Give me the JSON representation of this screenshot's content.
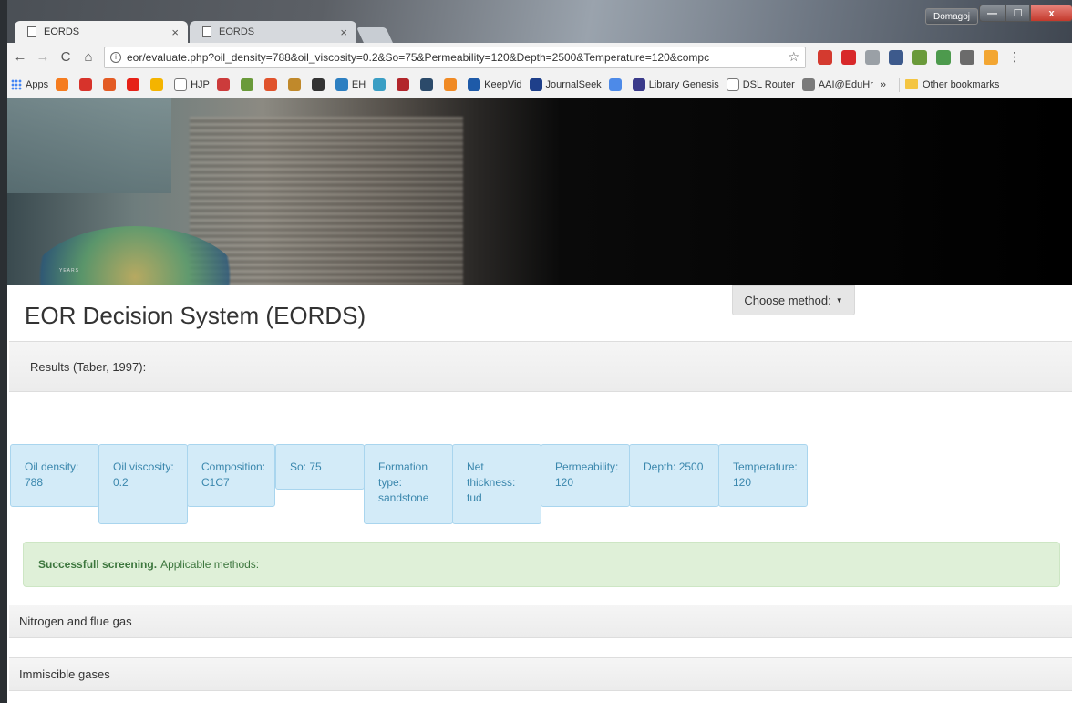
{
  "browser": {
    "tabs": [
      {
        "title": "EORDS",
        "active": true
      },
      {
        "title": "EORDS",
        "active": false
      }
    ],
    "profile_name": "Domagoj",
    "window_buttons": {
      "minimize": "—",
      "maximize": "☐",
      "close": "x"
    },
    "nav": {
      "back": "←",
      "forward": "→",
      "reload": "C",
      "home": "⌂"
    },
    "address": {
      "info": "i",
      "url": "eor/evaluate.php?oil_density=788&oil_viscosity=0.2&So=75&Permeability=120&Depth=2500&Temperature=120&compc",
      "star": "☆"
    },
    "menu": "⋮",
    "bookmarks": [
      {
        "label": "Apps",
        "icon": "apps-grid-icon"
      },
      {
        "label": "",
        "icon": "firefox-icon",
        "color": "#f57c1f"
      },
      {
        "label": "",
        "icon": "bank-icon",
        "color": "#d7332b"
      },
      {
        "label": "",
        "icon": "e-icon",
        "color": "#e35b24"
      },
      {
        "label": "",
        "icon": "youtube-icon",
        "color": "#e62117"
      },
      {
        "label": "",
        "icon": "drive-icon",
        "color": "#f4b400"
      },
      {
        "label": "HJP",
        "icon": "doc-icon",
        "color": "#ffffff"
      },
      {
        "label": "",
        "icon": "mendeley-icon",
        "color": "#cc3b3b"
      },
      {
        "label": "",
        "icon": "arrow-icon",
        "color": "#6a9a3a"
      },
      {
        "label": "",
        "icon": "sun-icon",
        "color": "#e0532c"
      },
      {
        "label": "",
        "icon": "lion-icon",
        "color": "#c0892b"
      },
      {
        "label": "",
        "icon": "t-icon",
        "color": "#333333"
      },
      {
        "label": "EH",
        "icon": "eh-icon",
        "color": "#2d7fc1"
      },
      {
        "label": "",
        "icon": "yb-icon",
        "color": "#3a9ec4"
      },
      {
        "label": "",
        "icon": "nist-icon",
        "color": "#b2262b"
      },
      {
        "label": "",
        "icon": "c-icon",
        "color": "#2b4a6a"
      },
      {
        "label": "",
        "icon": "orange-icon",
        "color": "#f08a24"
      },
      {
        "label": "KeepVid",
        "icon": "keepvid-icon",
        "color": "#1e5aa8"
      },
      {
        "label": "JournalSeek",
        "icon": "journalseek-icon",
        "color": "#1e3f8a"
      },
      {
        "label": "",
        "icon": "scholar-icon",
        "color": "#4d8ae8"
      },
      {
        "label": "Library Genesis",
        "icon": "libgen-icon",
        "color": "#3a3a8a"
      },
      {
        "label": "DSL Router",
        "icon": "doc-icon",
        "color": "#ffffff"
      },
      {
        "label": "AAI@EduHr",
        "icon": "aai-icon",
        "color": "#7a7a7a"
      },
      {
        "label": "»",
        "icon": "",
        "color": ""
      },
      {
        "label": "Other bookmarks",
        "icon": "folder-icon",
        "color": "#f4c542"
      }
    ],
    "extensions": [
      {
        "name": "bookmark-icon",
        "color": "#d43a2f"
      },
      {
        "name": "adblock-icon",
        "color": "#d8282a"
      },
      {
        "name": "drive-ext-icon",
        "color": "#9aa0a6"
      },
      {
        "name": "reader-icon",
        "color": "#3d5a8c"
      },
      {
        "name": "puzzle-icon",
        "color": "#6a9a3a"
      },
      {
        "name": "frog-icon",
        "color": "#4d9a4d"
      },
      {
        "name": "stack-icon",
        "color": "#6b6b6b"
      },
      {
        "name": "hand-icon",
        "color": "#f3a632"
      }
    ]
  },
  "page": {
    "banner_axis": "YEARS",
    "title": "EOR Decision System (EORDS)",
    "choose_method": "Choose method:",
    "results_heading": "Results (Taber, 1997):",
    "parameters": [
      "Oil density: 788",
      "Oil viscosity: 0.2",
      "Composition: C1C7",
      "So: 75",
      "Formation type: sandstone",
      "Net thickness: tud",
      "Permeability: 120",
      "Depth: 2500",
      "Temperature: 120"
    ],
    "alert": {
      "bold": "Successfull screening.",
      "text": "Applicable methods:"
    },
    "methods": [
      "Nitrogen and flue gas",
      "Immiscible gases"
    ]
  }
}
